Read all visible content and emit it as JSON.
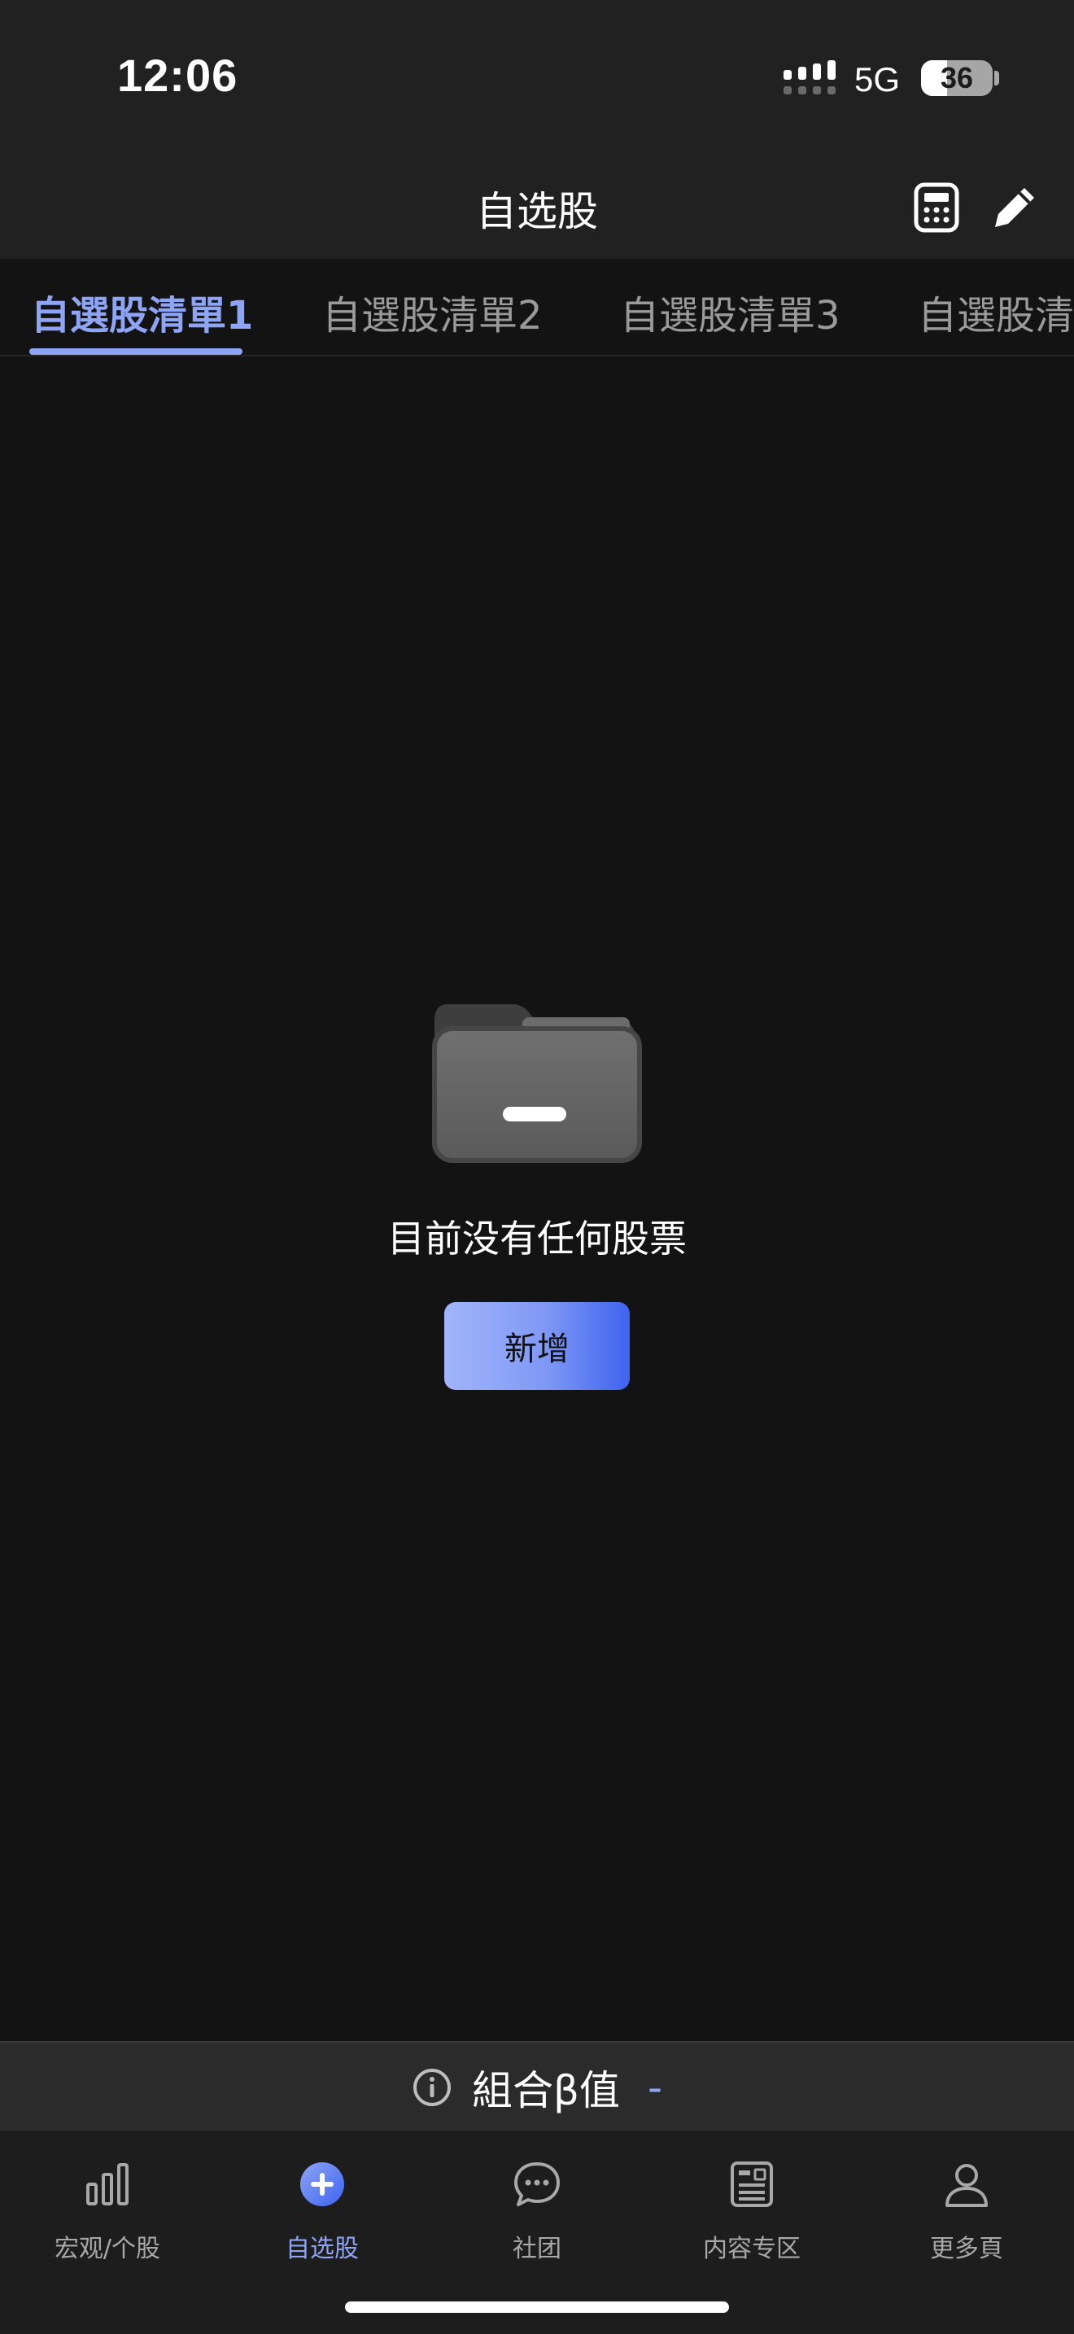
{
  "status_bar": {
    "time": "12:06",
    "network": "5G",
    "battery_level": "36"
  },
  "header": {
    "title": "自选股",
    "calculator_icon": "calculator-icon",
    "edit_icon": "pencil-icon"
  },
  "tabs": [
    {
      "label": "自選股清單1",
      "active": true
    },
    {
      "label": "自選股清單2",
      "active": false
    },
    {
      "label": "自選股清單3",
      "active": false
    },
    {
      "label": "自選股清",
      "active": false
    }
  ],
  "empty_state": {
    "icon": "folder-icon",
    "message": "目前没有任何股票",
    "add_button": "新增"
  },
  "beta_bar": {
    "label": "組合β值",
    "value": "-",
    "icon": "info-icon"
  },
  "bottom_nav": [
    {
      "label": "宏观/个股",
      "icon": "bar-chart-icon",
      "active": false
    },
    {
      "label": "自选股",
      "icon": "plus-circle-icon",
      "active": true
    },
    {
      "label": "社团",
      "icon": "chat-bubble-icon",
      "active": false
    },
    {
      "label": "内容专区",
      "icon": "news-icon",
      "active": false
    },
    {
      "label": "更多頁",
      "icon": "person-icon",
      "active": false
    }
  ],
  "colors": {
    "accent": "#8ea5f6",
    "button_gradient_end": "#3e63ef",
    "background": "#131313",
    "bar": "#212121"
  }
}
